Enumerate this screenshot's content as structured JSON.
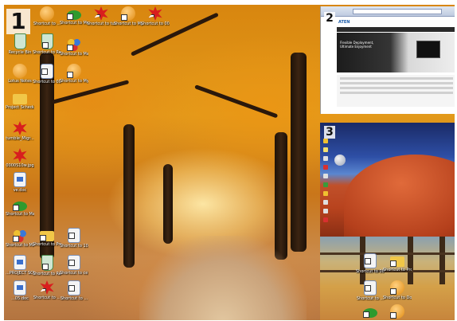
{
  "monitors": {
    "monitor_1_number": "1",
    "monitor_2_number": "2",
    "monitor_3_number": "3"
  },
  "desktop_icons": [
    {
      "id": "i1",
      "label": "Recycle Bin",
      "icon": "recycle-bin-icon"
    },
    {
      "id": "i2",
      "label": "Lotus Notes",
      "icon": "lotus-notes-icon"
    },
    {
      "id": "i3",
      "label": "Project Schedule",
      "icon": "folder-icon"
    },
    {
      "id": "i4",
      "label": "tumble_Migr...",
      "icon": "red-app-icon"
    },
    {
      "id": "i5",
      "label": "0000S10w.jpg",
      "icon": "red-app-icon"
    },
    {
      "id": "i6",
      "label": "ve.doc",
      "icon": "document-icon"
    },
    {
      "id": "i7",
      "label": "Shortcut to Manuals",
      "icon": "green-shortcut-icon"
    },
    {
      "id": "i8",
      "label": "Shortcut to Manuals on ...",
      "icon": "network-people-icon"
    },
    {
      "id": "i9",
      "label": "...PROJECT SCHEDULE",
      "icon": "document-icon"
    },
    {
      "id": "i10",
      "label": "...05.doc",
      "icon": "document-icon"
    },
    {
      "id": "i11",
      "label": "Shortcut to Recycle Bin",
      "icon": "recycle-bin-icon"
    },
    {
      "id": "i12",
      "label": "Shortcut to 0000S10w.jpg",
      "icon": "document-icon"
    },
    {
      "id": "i13",
      "label": "Shortcut to Project...",
      "icon": "folder-icon"
    },
    {
      "id": "i14",
      "label": "Shortcut to My Documents (2)",
      "icon": "orange-app-icon"
    },
    {
      "id": "i15",
      "label": "Shortcut to Manuals on...",
      "icon": "people-icon"
    },
    {
      "id": "i16",
      "label": "Shortcut to tumble_m2c...",
      "icon": "red-app-icon"
    },
    {
      "id": "i17",
      "label": "Shortcut to Manuals (2)",
      "icon": "green-shortcut-icon"
    },
    {
      "id": "i18",
      "label": "Shortcut to My Documents",
      "icon": "orange-app-icon"
    },
    {
      "id": "i19",
      "label": "Shortcut to 0000S10w(2)",
      "icon": "red-app-icon"
    },
    {
      "id": "i20",
      "label": "Shortcut to ...",
      "icon": "orange-app-icon"
    },
    {
      "id": "i21",
      "label": "Shortcut to 10408_Ship...",
      "icon": "document-icon"
    },
    {
      "id": "i22",
      "label": "Shortcut to ce1164_lth...",
      "icon": "document-icon"
    },
    {
      "id": "i23",
      "label": "Shortcut to ...",
      "icon": "red-app-icon"
    },
    {
      "id": "i24",
      "label": "Shortcut to ...",
      "icon": "document-icon"
    },
    {
      "id": "i25",
      "label": "Shortcut to 0007 Dellve...",
      "icon": "document-icon"
    },
    {
      "id": "i26",
      "label": "Shortcut to Project Sche...",
      "icon": "folder-icon"
    },
    {
      "id": "i27",
      "label": "Shortcut to ...",
      "icon": "document-icon"
    },
    {
      "id": "i28",
      "label": "Shortcut to Docu...",
      "icon": "orange-app-icon"
    },
    {
      "id": "i29",
      "label": "",
      "icon": "green-shortcut-icon"
    },
    {
      "id": "i30",
      "label": "",
      "icon": "orange-app-icon"
    }
  ],
  "monitor2": {
    "site_logo": "ATEN",
    "hero_text": "Flexible Deployment, Ultimate Enjoyment"
  }
}
